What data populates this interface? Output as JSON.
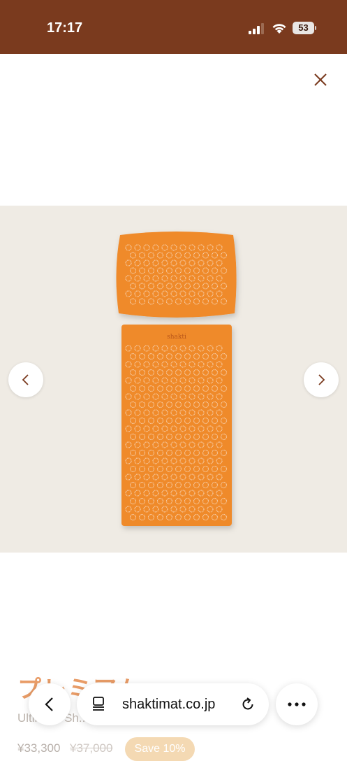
{
  "status_bar": {
    "time": "17:17",
    "battery": "53"
  },
  "product": {
    "title": "プレミアム",
    "subtitle": "Ultimate Sh...",
    "price": "¥33,300",
    "old_price": "¥37,000",
    "save_badge": "Save 10%"
  },
  "browser": {
    "domain": "shaktimat.co.jp"
  },
  "gallery": {
    "mat_logo_text": "shakti"
  },
  "colors": {
    "status_bar": "#7a3a1e",
    "mat_orange": "#ef8a2c",
    "gallery_bg": "#efebe4"
  }
}
